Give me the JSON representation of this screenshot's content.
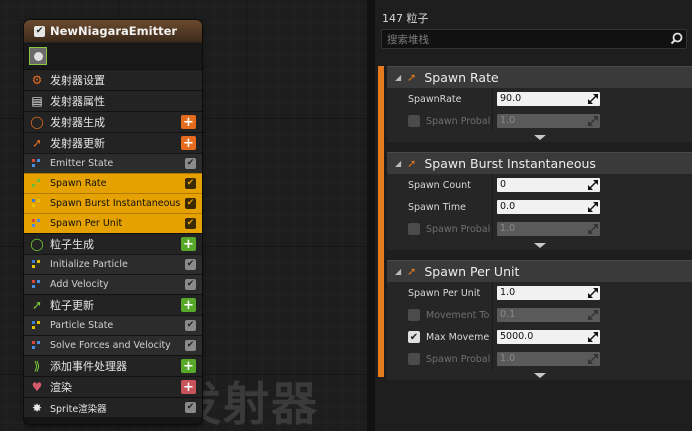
{
  "graph": {
    "watermark": "发射器",
    "node": {
      "title": "NewNiagaraEmitter",
      "enabled_mark": "✔",
      "rows": [
        {
          "kind": "cat",
          "label": "发射器设置",
          "icon": "emitter-settings-icon",
          "icon_glyph": "⚙",
          "icon_color": "#e56b1f"
        },
        {
          "kind": "cat",
          "label": "发射器属性",
          "icon": "cpu-icon",
          "icon_glyph": "▤",
          "icon_color": "#e0e0e0"
        },
        {
          "kind": "cat",
          "label": "发射器生成",
          "icon": "spawn-ring-icon",
          "icon_glyph": "◯",
          "icon_color": "#e56b1f",
          "add": "+",
          "add_color": "orange"
        },
        {
          "kind": "cat",
          "label": "发射器更新",
          "icon": "update-arrow-icon",
          "icon_glyph": "➚",
          "icon_color": "#e56b1f",
          "add": "+",
          "add_color": "orange"
        },
        {
          "kind": "mod",
          "label": "Emitter State",
          "check": "✔"
        },
        {
          "kind": "mod",
          "label": "Spawn Rate",
          "check": "✔",
          "selected": true
        },
        {
          "kind": "mod",
          "label": "Spawn Burst Instantaneous",
          "check": "✔",
          "selected": true
        },
        {
          "kind": "mod",
          "label": "Spawn Per Unit",
          "check": "✔",
          "selected": true
        },
        {
          "kind": "cat",
          "label": "粒子生成",
          "icon": "particle-spawn-icon",
          "icon_glyph": "◯",
          "icon_color": "#7ecf3a",
          "add": "+",
          "add_color": "green"
        },
        {
          "kind": "mod",
          "label": "Initialize Particle",
          "check": "✔"
        },
        {
          "kind": "mod",
          "label": "Add Velocity",
          "check": "✔"
        },
        {
          "kind": "cat",
          "label": "粒子更新",
          "icon": "particle-update-icon",
          "icon_glyph": "➚",
          "icon_color": "#7ecf3a",
          "add": "+",
          "add_color": "green"
        },
        {
          "kind": "mod",
          "label": "Particle State",
          "check": "✔"
        },
        {
          "kind": "mod",
          "label": "Solve Forces and Velocity",
          "check": "✔"
        },
        {
          "kind": "cat",
          "label": "添加事件处理器",
          "icon": "event-handler-icon",
          "icon_glyph": "⟫",
          "icon_color": "#7ecf3a",
          "add": "+",
          "add_color": "green"
        },
        {
          "kind": "cat",
          "label": "渲染",
          "icon": "render-heart-icon",
          "icon_glyph": "♥",
          "icon_color": "#d65a6a",
          "add": "+",
          "add_color": "red"
        },
        {
          "kind": "cat-small",
          "label": "Sprite渲染器",
          "icon": "sprite-renderer-icon",
          "icon_glyph": "✸",
          "icon_color": "#e8e8e8",
          "check": "✔"
        }
      ]
    }
  },
  "panel": {
    "count": "147 粒子",
    "search_placeholder": "搜索堆栈",
    "sections": [
      {
        "title": "Spawn Rate",
        "rows": [
          {
            "label": "SpawnRate",
            "value": "90.0",
            "enabled": true
          },
          {
            "label": "Spawn Probal",
            "value": "1.0",
            "enabled": false,
            "checkbox": true,
            "checked": false
          }
        ]
      },
      {
        "title": "Spawn Burst Instantaneous",
        "rows": [
          {
            "label": "Spawn Count",
            "value": "0",
            "enabled": true
          },
          {
            "label": "Spawn Time",
            "value": "0.0",
            "enabled": true
          },
          {
            "label": "Spawn Probal",
            "value": "1.0",
            "enabled": false,
            "checkbox": true,
            "checked": false
          }
        ]
      },
      {
        "title": "Spawn Per Unit",
        "rows": [
          {
            "label": "Spawn Per Unit",
            "value": "1.0",
            "enabled": true
          },
          {
            "label": "Movement To",
            "value": "0.1",
            "enabled": false,
            "checkbox": true,
            "checked": false
          },
          {
            "label": "Max Moveme",
            "value": "5000.0",
            "enabled": true,
            "checkbox": true,
            "checked": true
          },
          {
            "label": "Spawn Probal",
            "value": "1.0",
            "enabled": false,
            "checkbox": true,
            "checked": false
          }
        ]
      }
    ],
    "check_mark": "✔"
  }
}
